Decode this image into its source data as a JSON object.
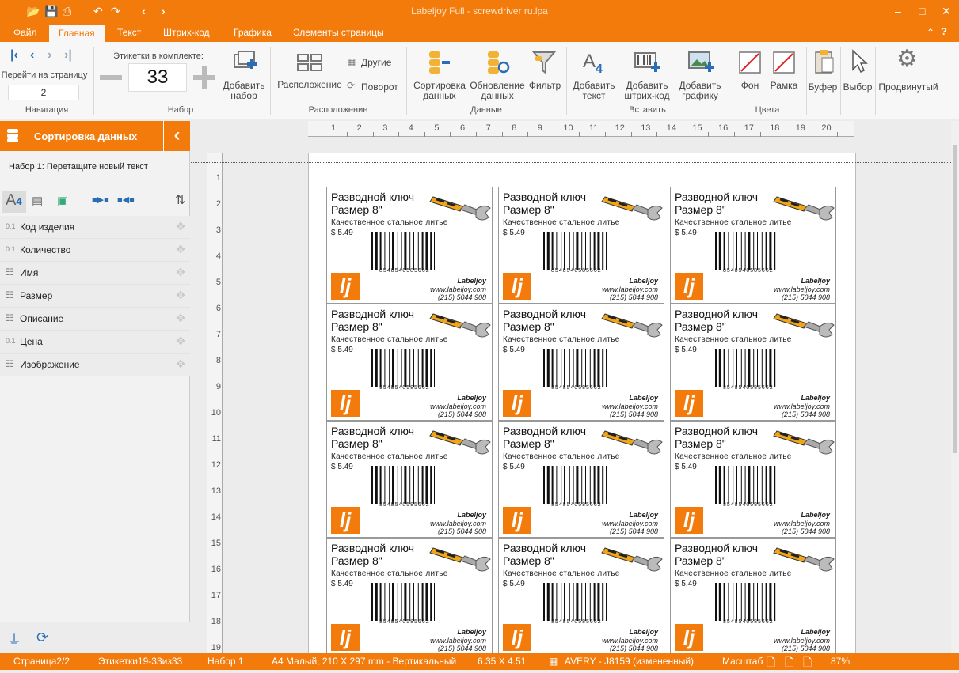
{
  "window": {
    "title": "Labeljoy Full - screwdriver ru.lpa"
  },
  "menu": [
    "Файл",
    "Главная",
    "Текст",
    "Штрих-код",
    "Графика",
    "Элементы страницы"
  ],
  "ribbon": {
    "navigation": {
      "goto_label": "Перейти на страницу",
      "page_value": "2",
      "group": "Навигация"
    },
    "set": {
      "labels_in_set": "Этикетки в комплекте:",
      "count": "33",
      "add_set": "Добавить набор",
      "group": "Набор"
    },
    "layout": {
      "arrangement": "Расположение",
      "others": "Другие",
      "rotate": "Поворот",
      "group": "Расположение"
    },
    "data": {
      "sort": "Сортировка данных",
      "update": "Обновление данных",
      "filter": "Фильтр",
      "group": "Данные"
    },
    "insert": {
      "add_text": "Добавить текст",
      "add_barcode": "Добавить штрих-код",
      "add_graphic": "Добавить графику",
      "group": "Вставить"
    },
    "colors": {
      "background": "Фон",
      "frame": "Рамка",
      "group": "Цвета"
    },
    "buffer": "Буфер",
    "select": "Выбор",
    "advanced": "Продвинутый"
  },
  "panel": {
    "title": "Сортировка данных",
    "hint": "Набор 1: Перетащите новый текст",
    "fields": [
      {
        "icon": "0.1",
        "name": "Код изделия"
      },
      {
        "icon": "0.1",
        "name": "Количество"
      },
      {
        "icon": "doc",
        "name": "Имя"
      },
      {
        "icon": "doc",
        "name": "Размер"
      },
      {
        "icon": "doc",
        "name": "Описание"
      },
      {
        "icon": "0.1",
        "name": "Цена"
      },
      {
        "icon": "doc",
        "name": "Изображение"
      }
    ]
  },
  "rulers": {
    "h": [
      "1",
      "2",
      "3",
      "4",
      "5",
      "6",
      "7",
      "8",
      "9",
      "10",
      "11",
      "12",
      "13",
      "14",
      "15",
      "16",
      "17",
      "18",
      "19",
      "20"
    ],
    "v": [
      "1",
      "2",
      "3",
      "4",
      "5",
      "6",
      "7",
      "8",
      "9",
      "10",
      "11",
      "12",
      "13",
      "14",
      "15",
      "16",
      "17",
      "18",
      "19"
    ]
  },
  "label": {
    "title": "Разводной ключ",
    "size": "Размер 8\"",
    "description": "Качественное стальное литье",
    "price": "$ 5.49",
    "barcode_number": "8548540585662",
    "brand": "Labeljoy",
    "website": "www.labeljoy.com",
    "phone": "(215) 5044 908"
  },
  "status": {
    "page": "Страница2/2",
    "labels": "Этикетки19-33из33",
    "set": "Набор 1",
    "paper": "A4 Малый, 210 X 297 mm - Вертикальный",
    "dims": "6.35 X 4.51",
    "template": "AVERY - J8159 (измененный)",
    "zoom_label": "Масштаб",
    "zoom": "87%"
  },
  "colors": {
    "accent": "#f27b0c"
  }
}
